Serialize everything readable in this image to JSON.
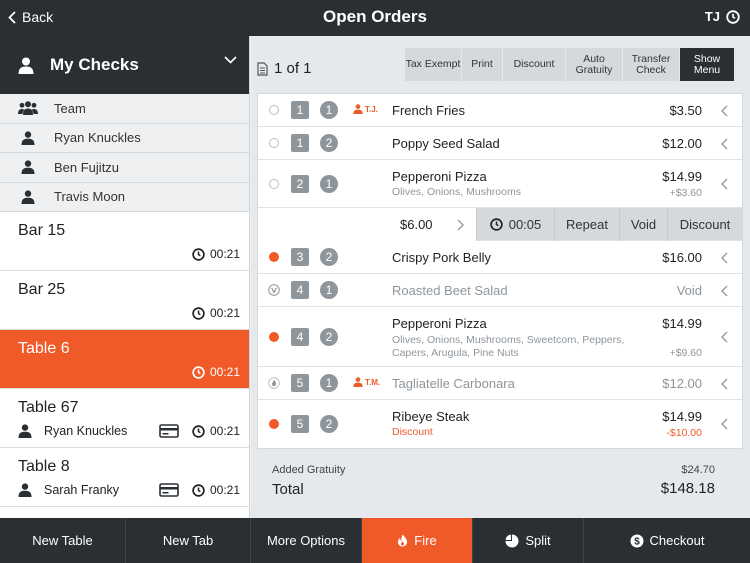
{
  "header": {
    "back_label": "Back",
    "title": "Open Orders",
    "user_initials": "TJ"
  },
  "sidebar": {
    "title": "My Checks",
    "staff": [
      {
        "label": "Team",
        "icon": "group-icon"
      },
      {
        "label": "Ryan Knuckles",
        "icon": "person-icon"
      },
      {
        "label": "Ben Fujitzu",
        "icon": "person-icon"
      },
      {
        "label": "Travis Moon",
        "icon": "person-icon"
      }
    ],
    "checks": [
      {
        "name": "Bar 15",
        "time": "00:21",
        "owner": "",
        "card": false,
        "active": false
      },
      {
        "name": "Bar 25",
        "time": "00:21",
        "owner": "",
        "card": false,
        "active": false
      },
      {
        "name": "Table 6",
        "time": "00:21",
        "owner": "",
        "card": false,
        "active": true
      },
      {
        "name": "Table 67",
        "time": "00:21",
        "owner": "Ryan Knuckles",
        "card": true,
        "active": false
      },
      {
        "name": "Table 8",
        "time": "00:21",
        "owner": "Sarah Franky",
        "card": true,
        "active": false
      }
    ]
  },
  "main": {
    "pager": "1 of 1",
    "toolbar": [
      "Tax Exempt",
      "Print",
      "Discount",
      "Auto Gratuity",
      "Transfer Check",
      "Show Menu"
    ],
    "orders": [
      {
        "status": "open",
        "seat": "1",
        "course": "1",
        "tag": "T.J.",
        "item": "French Fries",
        "price": "$3.50"
      },
      {
        "status": "open",
        "seat": "1",
        "course": "2",
        "item": "Poppy Seed Salad",
        "price": "$12.00"
      },
      {
        "status": "open",
        "seat": "2",
        "course": "1",
        "item": "Pepperoni Pizza",
        "mods": "Olives, Onions, Mushrooms",
        "price": "$14.99",
        "sub": "+$3.60"
      },
      {
        "status": "fired",
        "seat": "3",
        "course": "2",
        "item": "Crispy Pork Belly",
        "price": "$16.00"
      },
      {
        "status": "void",
        "seat": "4",
        "course": "1",
        "item": "Roasted Beet Salad",
        "price": "Void"
      },
      {
        "status": "fired",
        "seat": "4",
        "course": "2",
        "item": "Pepperoni Pizza",
        "mods": "Olives, Onions, Mushrooms, Sweetcorn, Peppers, Capers, Arugula, Pine Nuts",
        "price": "$14.99",
        "sub": "+$9.60"
      },
      {
        "status": "hold",
        "seat": "5",
        "course": "1",
        "tag": "T.M.",
        "item": "Tagliatelle Carbonara",
        "price": "$12.00"
      },
      {
        "status": "fired",
        "seat": "5",
        "course": "2",
        "item": "Ribeye Steak",
        "mods": "Discount",
        "price": "$14.99",
        "sub": "-$10.00"
      }
    ],
    "action_bar": {
      "amount": "$6.00",
      "timer": "00:05",
      "repeat": "Repeat",
      "void": "Void",
      "discount": "Discount"
    },
    "totals": {
      "gratuity_label": "Added Gratuity",
      "gratuity_value": "$24.70",
      "total_label": "Total",
      "total_value": "$148.18"
    }
  },
  "bottom_bar": [
    "New Table",
    "New Tab",
    "More Options",
    "Fire",
    "Split",
    "Checkout"
  ],
  "colors": {
    "accent": "#f05a28",
    "dark": "#2a2f33",
    "badge": "#8e969c"
  }
}
